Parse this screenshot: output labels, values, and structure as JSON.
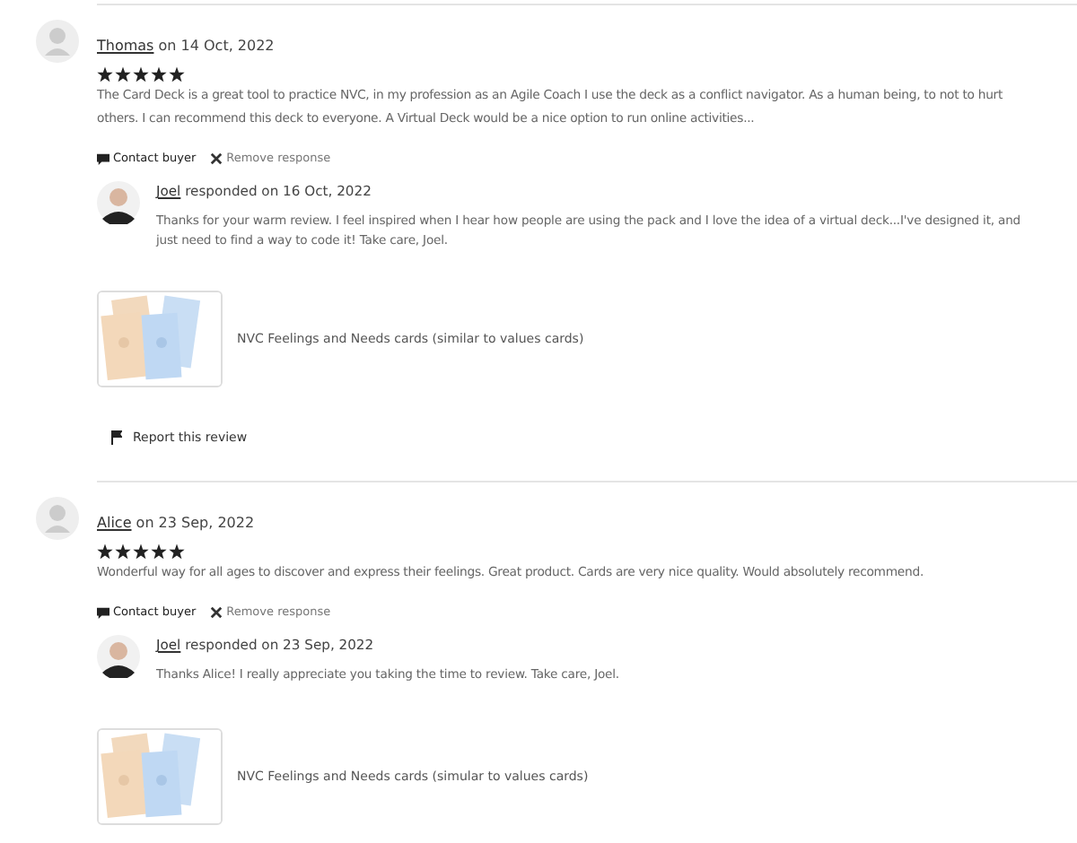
{
  "reviews": [
    {
      "reviewer": "Thomas",
      "date": "on 14 Oct, 2022",
      "stars": 5,
      "text": "The Card Deck is a great tool to practice NVC, in my profession as an Agile Coach I use the deck as a conflict navigator. As a human being, to not to hurt others. I can recommend this deck to everyone. A Virtual Deck would be a nice option to run online activities...",
      "actions": [
        "Contact buyer",
        "Remove response"
      ],
      "response": {
        "author": "Joel",
        "date": "responded on 16 Oct, 2022",
        "text": "Thanks for your warm review. I feel inspired when I hear how people are using the pack and I love the idea of a virtual deck...I've designed it, and just need to find a way to code it! Take care, Joel."
      },
      "product": {
        "kind": "picture",
        "title": "NVC Feelings and Needs cards (similar to values cards)"
      },
      "report": "Report this review"
    },
    {
      "reviewer": "Alice",
      "date": "on 23 Sep, 2022",
      "stars": 5,
      "text": "Wonderful way for all ages to discover and express their feelings. Great product. Cards are very nice quality. Would absolutely recommend.",
      "actions": [
        "Contact buyer",
        "Remove response"
      ],
      "response": {
        "author": "Joel",
        "date": "responded on 23 Sep, 2022",
        "text": "Thanks Alice! I really appreciate you taking the time to review. Take care, Joel."
      },
      "product": {
        "kind": "picture",
        "title": "NVC Feelings and Needs cards (simular to values cards)"
      }
    }
  ]
}
